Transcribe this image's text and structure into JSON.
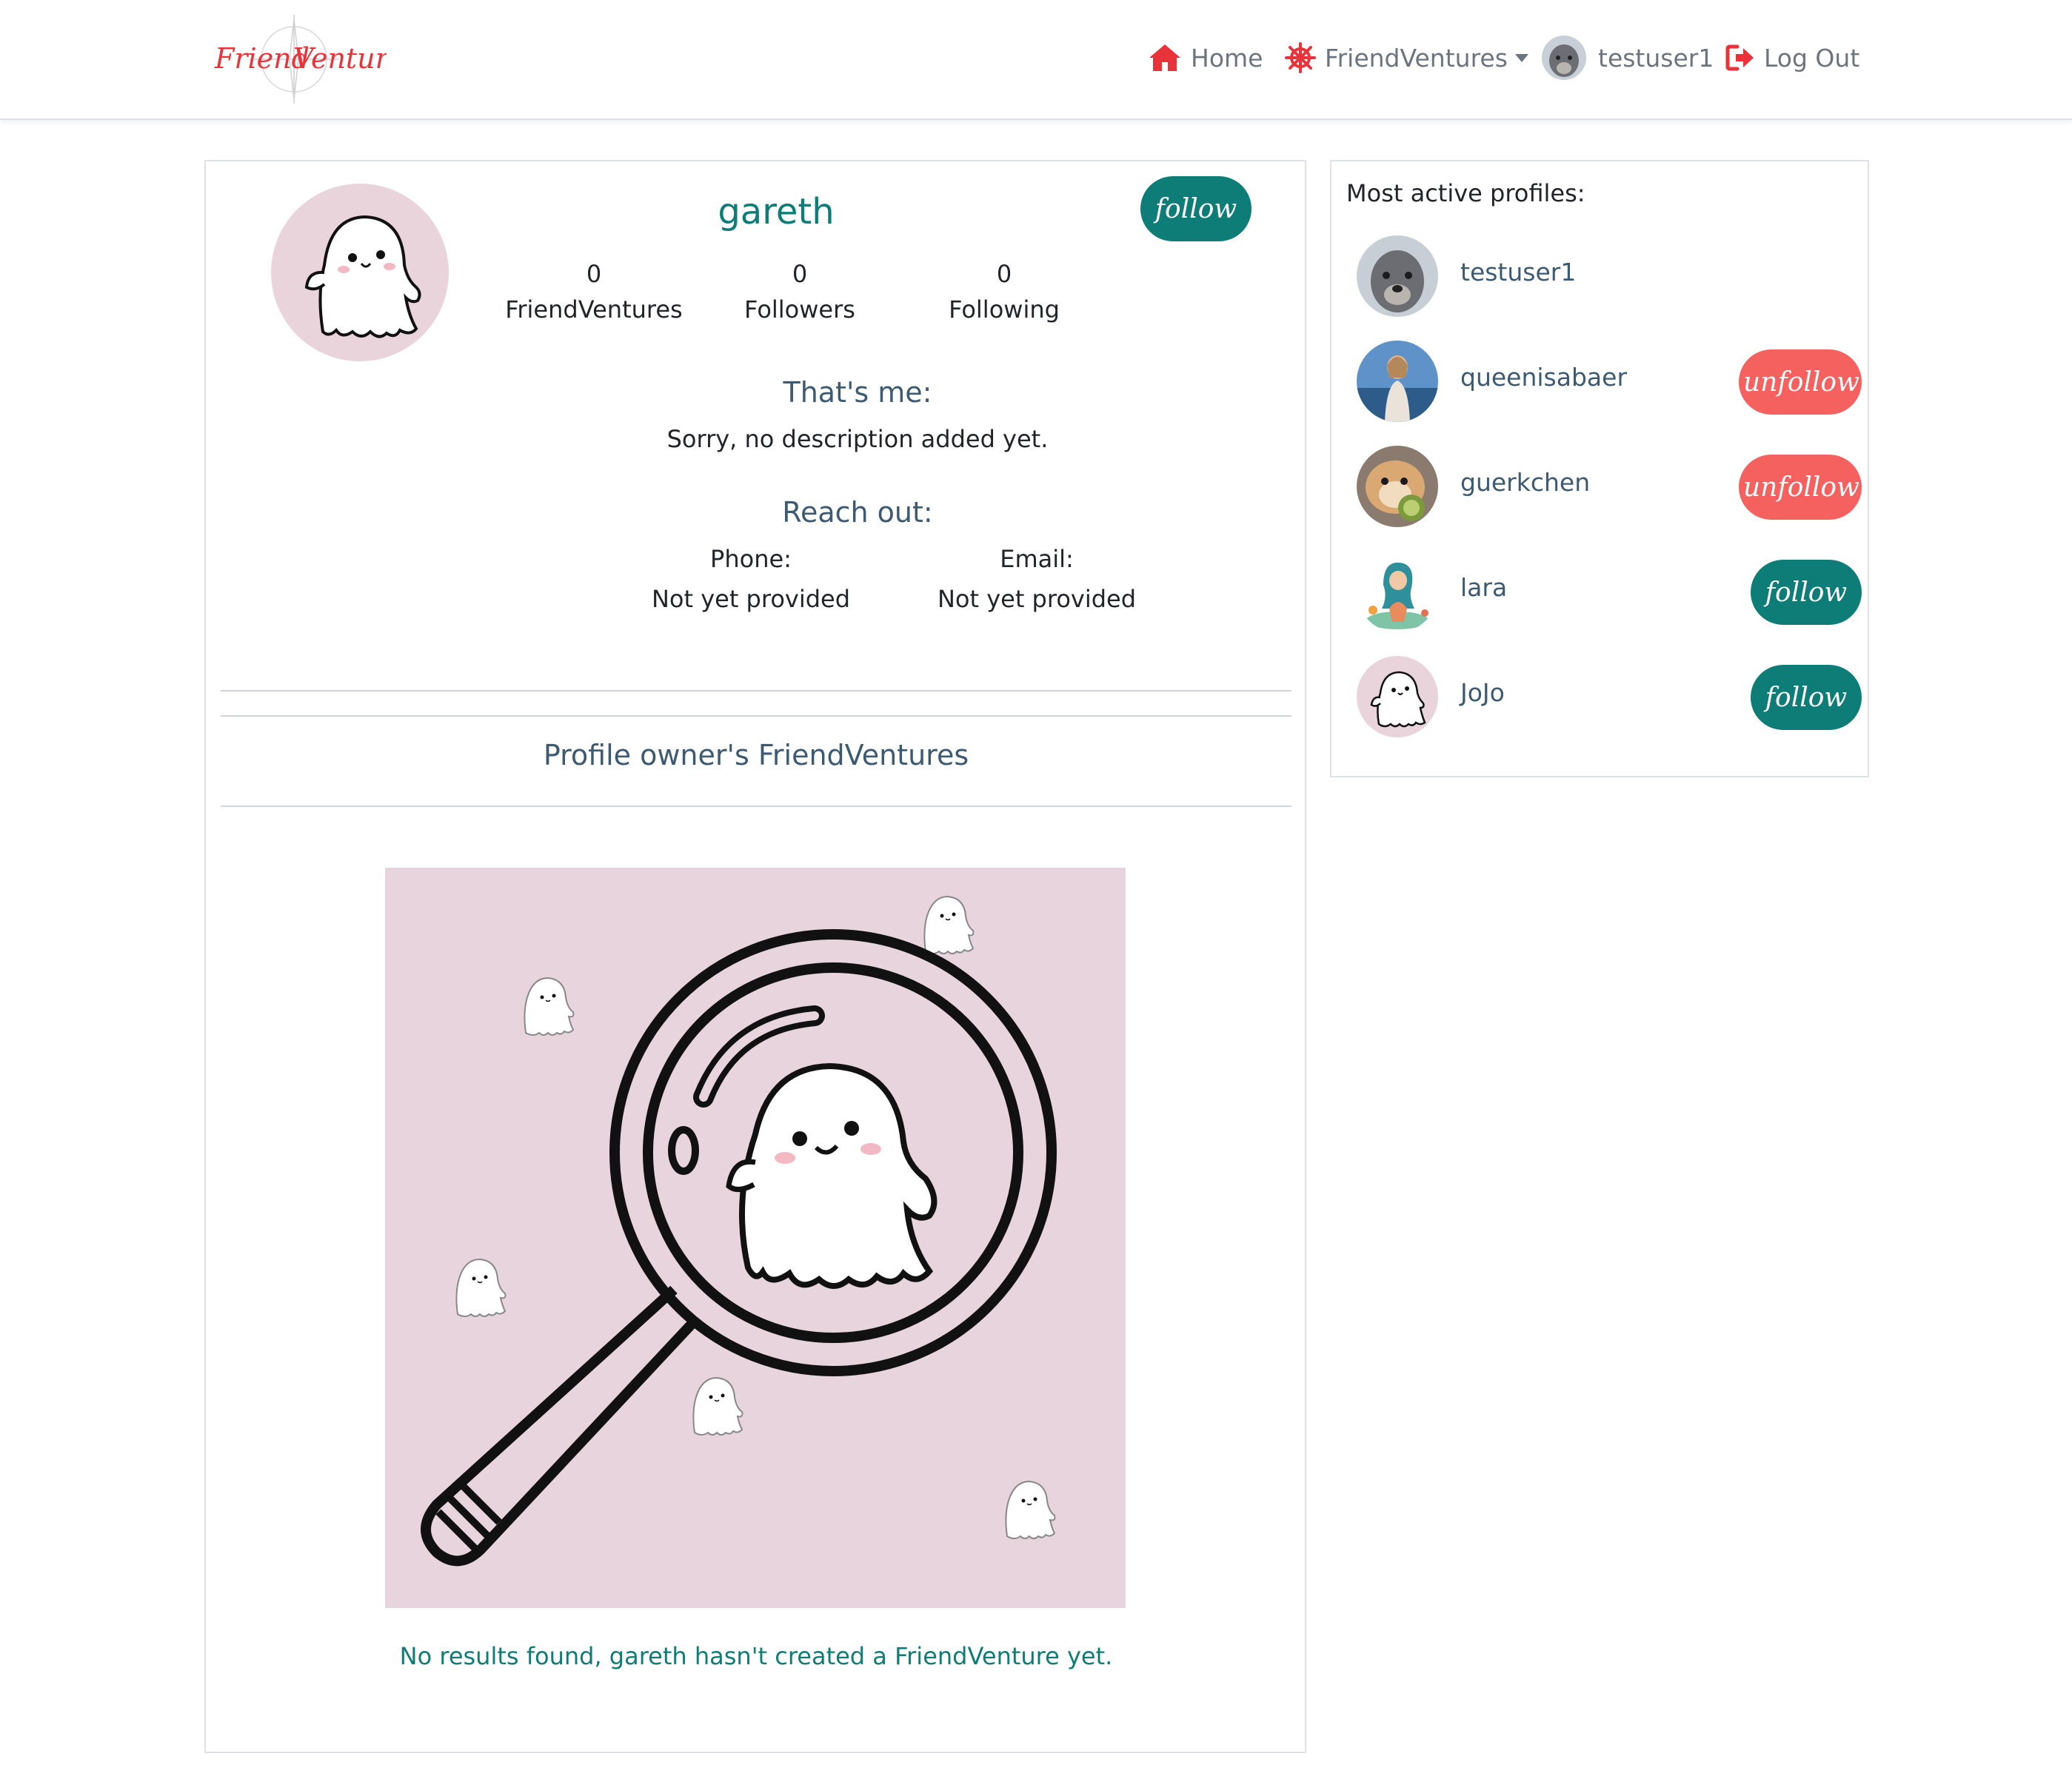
{
  "nav": {
    "brand": "FriendVenture",
    "home": "Home",
    "friendventures": "FriendVentures",
    "user": "testuser1",
    "logout": "Log Out"
  },
  "profile": {
    "username": "gareth",
    "follow_label": "follow",
    "stats": [
      {
        "value": "0",
        "label": "FriendVentures"
      },
      {
        "value": "0",
        "label": "Followers"
      },
      {
        "value": "0",
        "label": "Following"
      }
    ],
    "about_title": "That's me:",
    "description": "Sorry, no description added yet.",
    "reach_title": "Reach out:",
    "phone_label": "Phone:",
    "phone_value": "Not yet provided",
    "email_label": "Email:",
    "email_value": "Not yet provided"
  },
  "friendventures": {
    "heading": "Profile owner's FriendVentures",
    "empty_text": "No results found, gareth hasn't created a FriendVenture yet."
  },
  "sidebar": {
    "title": "Most active profiles:",
    "profiles": [
      {
        "name": "testuser1",
        "action": ""
      },
      {
        "name": "queenisabaer",
        "action": "unfollow"
      },
      {
        "name": "guerkchen",
        "action": "unfollow"
      },
      {
        "name": "lara",
        "action": "follow"
      },
      {
        "name": "JoJo",
        "action": "follow"
      }
    ]
  },
  "colors": {
    "brand_red": "#e8333a",
    "teal": "#0e7c77",
    "unfollow": "#f4615f",
    "avatar_pink": "#e8d4dc"
  }
}
